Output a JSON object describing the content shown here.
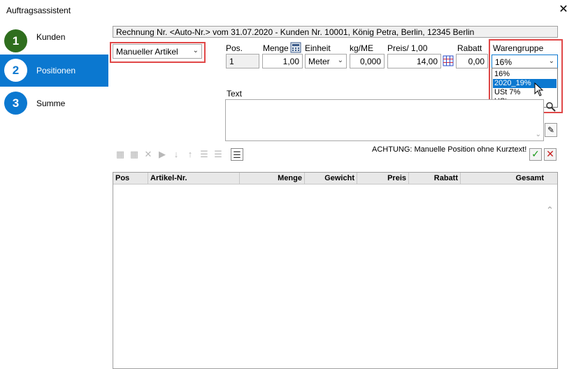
{
  "window": {
    "title": "Auftragsassistent",
    "close": "✕"
  },
  "nav": {
    "steps": [
      {
        "num": "1",
        "label": "Kunden",
        "color": "#2f6e1e"
      },
      {
        "num": "2",
        "label": "Positionen",
        "active": true
      },
      {
        "num": "3",
        "label": "Summe",
        "color": "#0b78d0"
      }
    ]
  },
  "info": "Rechnung Nr. <Auto-Nr.> vom 31.07.2020 - Kunden Nr. 10001, König Petra, Berlin, 12345 Berlin",
  "article_type": {
    "value": "Manueller Artikel"
  },
  "columns": {
    "pos": "Pos.",
    "menge": "Menge",
    "einheit": "Einheit",
    "kgme": "kg/ME",
    "preis": "Preis/ 1,00",
    "rabatt": "Rabatt",
    "warengruppe": "Warengruppe"
  },
  "fields": {
    "pos": "1",
    "menge": "1,00",
    "einheit": "Meter",
    "kgme": "0,000",
    "preis": "14,00",
    "rabatt": "0,00",
    "warengruppe": "16%"
  },
  "warengruppe_options": [
    "16%",
    "2020_19%",
    "USt 7%",
    "USt-norm"
  ],
  "text_label": "Text",
  "warning": "ACHTUNG: Manuelle Position ohne Kurztext!",
  "grid": {
    "headers": [
      "Pos",
      "Artikel-Nr.",
      "Menge",
      "Gewicht",
      "Preis",
      "Rabatt",
      "Gesamt"
    ]
  },
  "colors": {
    "accent": "#0b78d0",
    "highlight": "#e04848",
    "ok": "#1a9a1a",
    "cancel": "#c81e1e"
  }
}
